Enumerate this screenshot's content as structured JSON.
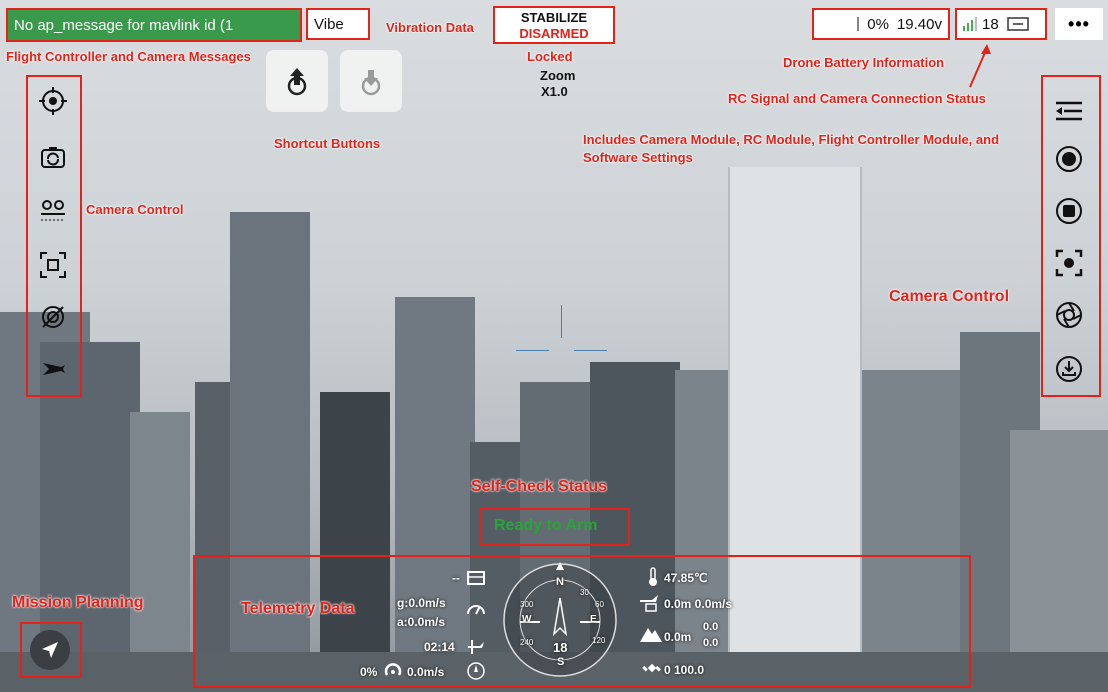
{
  "top": {
    "message": "No ap_message for mavlink id (1",
    "vibe": "Vibe",
    "mode": "STABILIZE",
    "arm_state": "DISARMED",
    "battery_percent": "0%",
    "battery_voltage": "19.40v",
    "signal_count": "18",
    "more": "•••"
  },
  "hud": {
    "locked": "Locked",
    "zoom_label": "Zoom",
    "zoom_value": "X1.0",
    "ready": "Ready to Arm"
  },
  "annotations": {
    "vibration": "Vibration Data",
    "fc_messages": "Flight Controller and Camera Messages",
    "drone_battery": "Drone Battery Information",
    "rc_signal": "RC Signal and Camera Connection Status",
    "includes": "Includes Camera Module, RC Module, Flight Controller Module, and",
    "includes2": "Software Settings",
    "shortcut": "Shortcut Buttons",
    "camera_left": "Camera Control",
    "camera_right": "Camera Control",
    "self_check": "Self-Check Status",
    "mission": "Mission Planning",
    "telemetry": "Telemetry Data"
  },
  "telemetry": {
    "dashes": "--",
    "ground_speed": "g:0.0m/s",
    "air_speed": "a:0.0m/s",
    "flight_time": "02:14",
    "throttle": "0%",
    "vertical_speed": "0.0m/s",
    "temperature": "47.85℃",
    "home_dist": "0.0m 0.0m/s",
    "altitude": "0.0m",
    "alt_top": "0.0",
    "alt_bottom": "0.0",
    "gps": "0 100.0",
    "compass_n": "N",
    "compass_s": "S",
    "compass_w": "W",
    "compass_e": "E",
    "heading": "18",
    "tick_30": "30",
    "tick_60": "60",
    "tick_120": "120",
    "tick_240": "240",
    "tick_300": "300"
  }
}
